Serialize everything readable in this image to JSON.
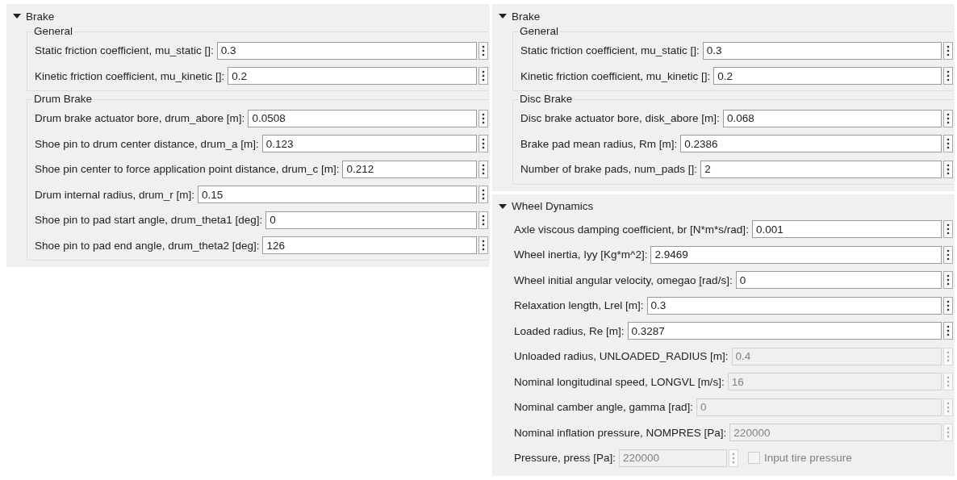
{
  "columns": [
    {
      "panels": [
        {
          "title": "Brake",
          "expanded": true,
          "groups": [
            {
              "title": "General",
              "params": [
                {
                  "label": "Static friction coefficient, mu_static []:",
                  "value": "0.3",
                  "disabled": false
                },
                {
                  "label": "Kinetic friction coefficient, mu_kinetic []:",
                  "value": "0.2",
                  "disabled": false
                }
              ]
            },
            {
              "title": "Drum Brake",
              "params": [
                {
                  "label": "Drum brake actuator bore, drum_abore [m]:",
                  "value": "0.0508",
                  "disabled": false
                },
                {
                  "label": "Shoe pin to drum center distance, drum_a [m]:",
                  "value": "0.123",
                  "disabled": false
                },
                {
                  "label": "Shoe pin center to force application point distance, drum_c [m]:",
                  "value": "0.212",
                  "disabled": false
                },
                {
                  "label": "Drum internal radius, drum_r [m]:",
                  "value": "0.15",
                  "disabled": false
                },
                {
                  "label": "Shoe pin to pad start angle, drum_theta1 [deg]:",
                  "value": "0",
                  "disabled": false
                },
                {
                  "label": "Shoe pin to pad end angle, drum_theta2 [deg]:",
                  "value": "126",
                  "disabled": false
                }
              ]
            }
          ]
        }
      ]
    },
    {
      "panels": [
        {
          "title": "Brake",
          "expanded": true,
          "groups": [
            {
              "title": "General",
              "params": [
                {
                  "label": "Static friction coefficient, mu_static []:",
                  "value": "0.3",
                  "disabled": false
                },
                {
                  "label": "Kinetic friction coefficient, mu_kinetic []:",
                  "value": "0.2",
                  "disabled": false
                }
              ]
            },
            {
              "title": "Disc Brake",
              "params": [
                {
                  "label": "Disc brake actuator bore, disk_abore [m]:",
                  "value": "0.068",
                  "disabled": false
                },
                {
                  "label": "Brake pad mean radius, Rm [m]:",
                  "value": "0.2386",
                  "disabled": false
                },
                {
                  "label": "Number of brake pads, num_pads []:",
                  "value": "2",
                  "disabled": false
                }
              ]
            }
          ]
        },
        {
          "title": "Wheel Dynamics",
          "expanded": true,
          "params": [
            {
              "label": "Axle viscous damping coefficient, br [N*m*s/rad]:",
              "value": "0.001",
              "disabled": false
            },
            {
              "label": "Wheel inertia, Iyy [Kg*m^2]:",
              "value": "2.9469",
              "disabled": false
            },
            {
              "label": "Wheel initial angular velocity, omegao [rad/s]:",
              "value": "0",
              "disabled": false
            },
            {
              "label": "Relaxation length, Lrel [m]:",
              "value": "0.3",
              "disabled": false
            },
            {
              "label": "Loaded radius, Re [m]:",
              "value": "0.3287",
              "disabled": false
            },
            {
              "label": "Unloaded radius, UNLOADED_RADIUS [m]:",
              "value": "0.4",
              "disabled": true
            },
            {
              "label": "Nominal longitudinal speed, LONGVL [m/s]:",
              "value": "16",
              "disabled": true
            },
            {
              "label": "Nominal camber angle, gamma [rad]:",
              "value": "0",
              "disabled": true
            },
            {
              "label": "Nominal inflation pressure, NOMPRES [Pa]:",
              "value": "220000",
              "disabled": true
            },
            {
              "label": "Pressure, press [Pa]:",
              "value": "220000",
              "disabled": true,
              "checkbox": {
                "label": "Input tire pressure",
                "checked": false,
                "disabled": true
              }
            }
          ]
        }
      ]
    }
  ]
}
